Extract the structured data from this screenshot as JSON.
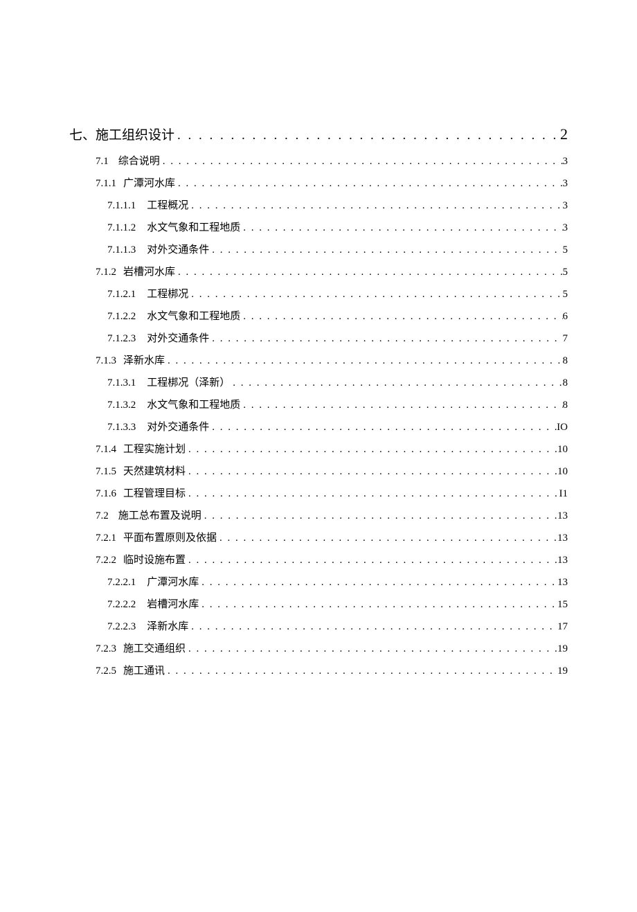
{
  "toc": [
    {
      "level": 0,
      "num": "七、",
      "title": "施工组织设计",
      "page": "2"
    },
    {
      "level": 1,
      "num": "7.1",
      "title": "综合说明",
      "page": "3"
    },
    {
      "level": 2,
      "num": "7.1.1",
      "title": "广潭河水库",
      "page": "3"
    },
    {
      "level": 3,
      "num": "7.1.1.1",
      "title": "工程概况",
      "page": "3"
    },
    {
      "level": 3,
      "num": "7.1.1.2",
      "title": "水文气象和工程地质",
      "page": "3"
    },
    {
      "level": 3,
      "num": "7.1.1.3",
      "title": "对外交通条件",
      "page": "5"
    },
    {
      "level": 2,
      "num": "7.1.2",
      "title": "岩槽河水库",
      "page": "5"
    },
    {
      "level": 3,
      "num": "7.1.2.1",
      "title": "工程梆况",
      "page": "5"
    },
    {
      "level": 3,
      "num": "7.1.2.2",
      "title": "水文气象和工程地质",
      "page": "6"
    },
    {
      "level": 3,
      "num": "7.1.2.3",
      "title": "对外交通条件",
      "page": "7"
    },
    {
      "level": 2,
      "num": "7.1.3",
      "title": "泽新水库",
      "page": "8"
    },
    {
      "level": 3,
      "num": "7.1.3.1",
      "title": "工程梆况（泽新）",
      "page": "8"
    },
    {
      "level": 3,
      "num": "7.1.3.2",
      "title": "水文气象和工程地质",
      "page": "8"
    },
    {
      "level": 3,
      "num": "7.1.3.3",
      "title": "对外交通条件",
      "page": "IO"
    },
    {
      "level": 2,
      "num": "7.1.4",
      "title": "工程实施计划",
      "page": "10"
    },
    {
      "level": 2,
      "num": "7.1.5",
      "title": "天然建筑材料",
      "page": "10"
    },
    {
      "level": 2,
      "num": "7.1.6",
      "title": "工程管理目标",
      "page": "I1"
    },
    {
      "level": 1,
      "num": "7.2",
      "title": "施工总布置及说明",
      "page": "13"
    },
    {
      "level": 2,
      "num": "7.2.1",
      "title": "平面布置原则及依据",
      "page": "13"
    },
    {
      "level": 2,
      "num": "7.2.2",
      "title": "临时设施布置",
      "page": "13"
    },
    {
      "level": 3,
      "num": "7.2.2.1",
      "title": "广潭河水库",
      "page": "13"
    },
    {
      "level": 3,
      "num": "7.2.2.2",
      "title": "岩槽河水库",
      "page": "15"
    },
    {
      "level": 3,
      "num": "7.2.2.3",
      "title": "泽新水库",
      "page": "17"
    },
    {
      "level": 2,
      "num": "7.2.3",
      "title": "施工交通组织",
      "page": "19"
    },
    {
      "level": 2,
      "num": "7.2.5",
      "title": "施工通讯",
      "page": "19"
    }
  ]
}
